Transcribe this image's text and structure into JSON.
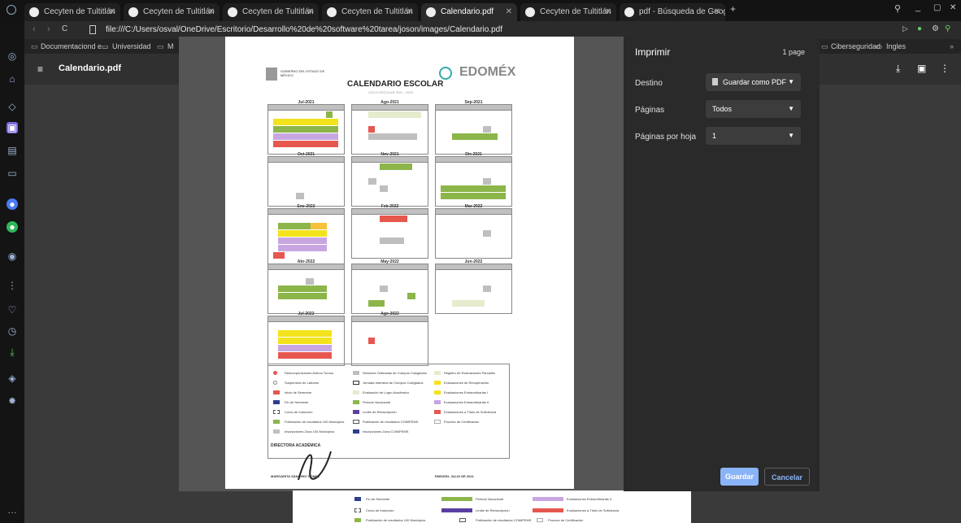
{
  "tabs": [
    {
      "label": "Cecyten de Tultitlán",
      "active": false
    },
    {
      "label": "Cecyten de Tultitlán",
      "active": false
    },
    {
      "label": "Cecyten de Tultitlán",
      "active": false
    },
    {
      "label": "Cecyten de Tultitlán",
      "active": false
    },
    {
      "label": "Calendario.pdf",
      "active": true
    },
    {
      "label": "Cecyten de Tultitlán",
      "active": false
    },
    {
      "label": "pdf - Búsqueda de Google",
      "active": false
    }
  ],
  "address": "file:///C:/Users/osval/OneDrive/Escritorio/Desarrollo%20de%20software%20tarea/joson/images/Calendario.pdf",
  "bookmarks": {
    "left": [
      "Documentaciond e...",
      "Universidad",
      "M"
    ],
    "right": [
      "Ciberseguridad",
      "Ingles"
    ]
  },
  "pdf": {
    "title": "Calendario.pdf"
  },
  "document": {
    "gov": "GOBIERNO DEL ESTADO DE MÉXICO",
    "brand": "EDOMÉX",
    "title": "CALENDARIO ESCOLAR",
    "subtitle": "CICLO ESCOLAR 2021 - 2022",
    "months": [
      "Jul-2021",
      "Ago-2021",
      "Sep-2021",
      "Oct-2021",
      "Nov-2021",
      "Dic-2021",
      "Ene-2022",
      "Feb-2022",
      "Mar-2022",
      "Abr-2022",
      "May-2022",
      "Jun-2022",
      "Jul-2022",
      "Ago-2022"
    ],
    "weekdays": "D L M M J V S",
    "signature_title": "DIRECTORA ACADÉMICA",
    "signature_name": "MARGARITA SÁNCHEZ GÓMEZ",
    "emission": "EMISIÓN: JULIO DE 2021",
    "legend": [
      "Reincorporaciones Ambos Turnos",
      "Suspensión de Labores",
      "Inicio de Semestre",
      "Fin de Semestre",
      "Curso de Inducción",
      "Publicación de resultados 100 Municipios",
      "Inscripciones Zona 100 Municipios",
      "Sesiones Ordinarias de Cuerpos Colegiados",
      "Jornada Intensiva de Cuerpos Colegiados",
      "Evaluación de Logro Académico",
      "Periodo Vacacional",
      "Límite de Reinscripción",
      "Publicación de resultados COMIPEMS",
      "Inscripciones Zona COMIPEMS",
      "Registro de Evaluaciones Parciales",
      "Evaluaciones de Recuperación",
      "Evaluaciones Extraordinarias I",
      "Evaluaciones Extraordinarias II",
      "Evaluaciones a Título de Suficiencia",
      "Proceso de Certificación"
    ]
  },
  "print": {
    "title": "Imprimir",
    "pages": "1 page",
    "destination_label": "Destino",
    "destination_value": "Guardar como PDF",
    "pages_label": "Páginas",
    "pages_value": "Todos",
    "per_sheet_label": "Páginas por hoja",
    "per_sheet_value": "1",
    "save": "Guardar",
    "cancel": "Cancelar"
  },
  "colors": {
    "accent": "#8ab4f8",
    "save_bg": "#8ab4f8"
  }
}
